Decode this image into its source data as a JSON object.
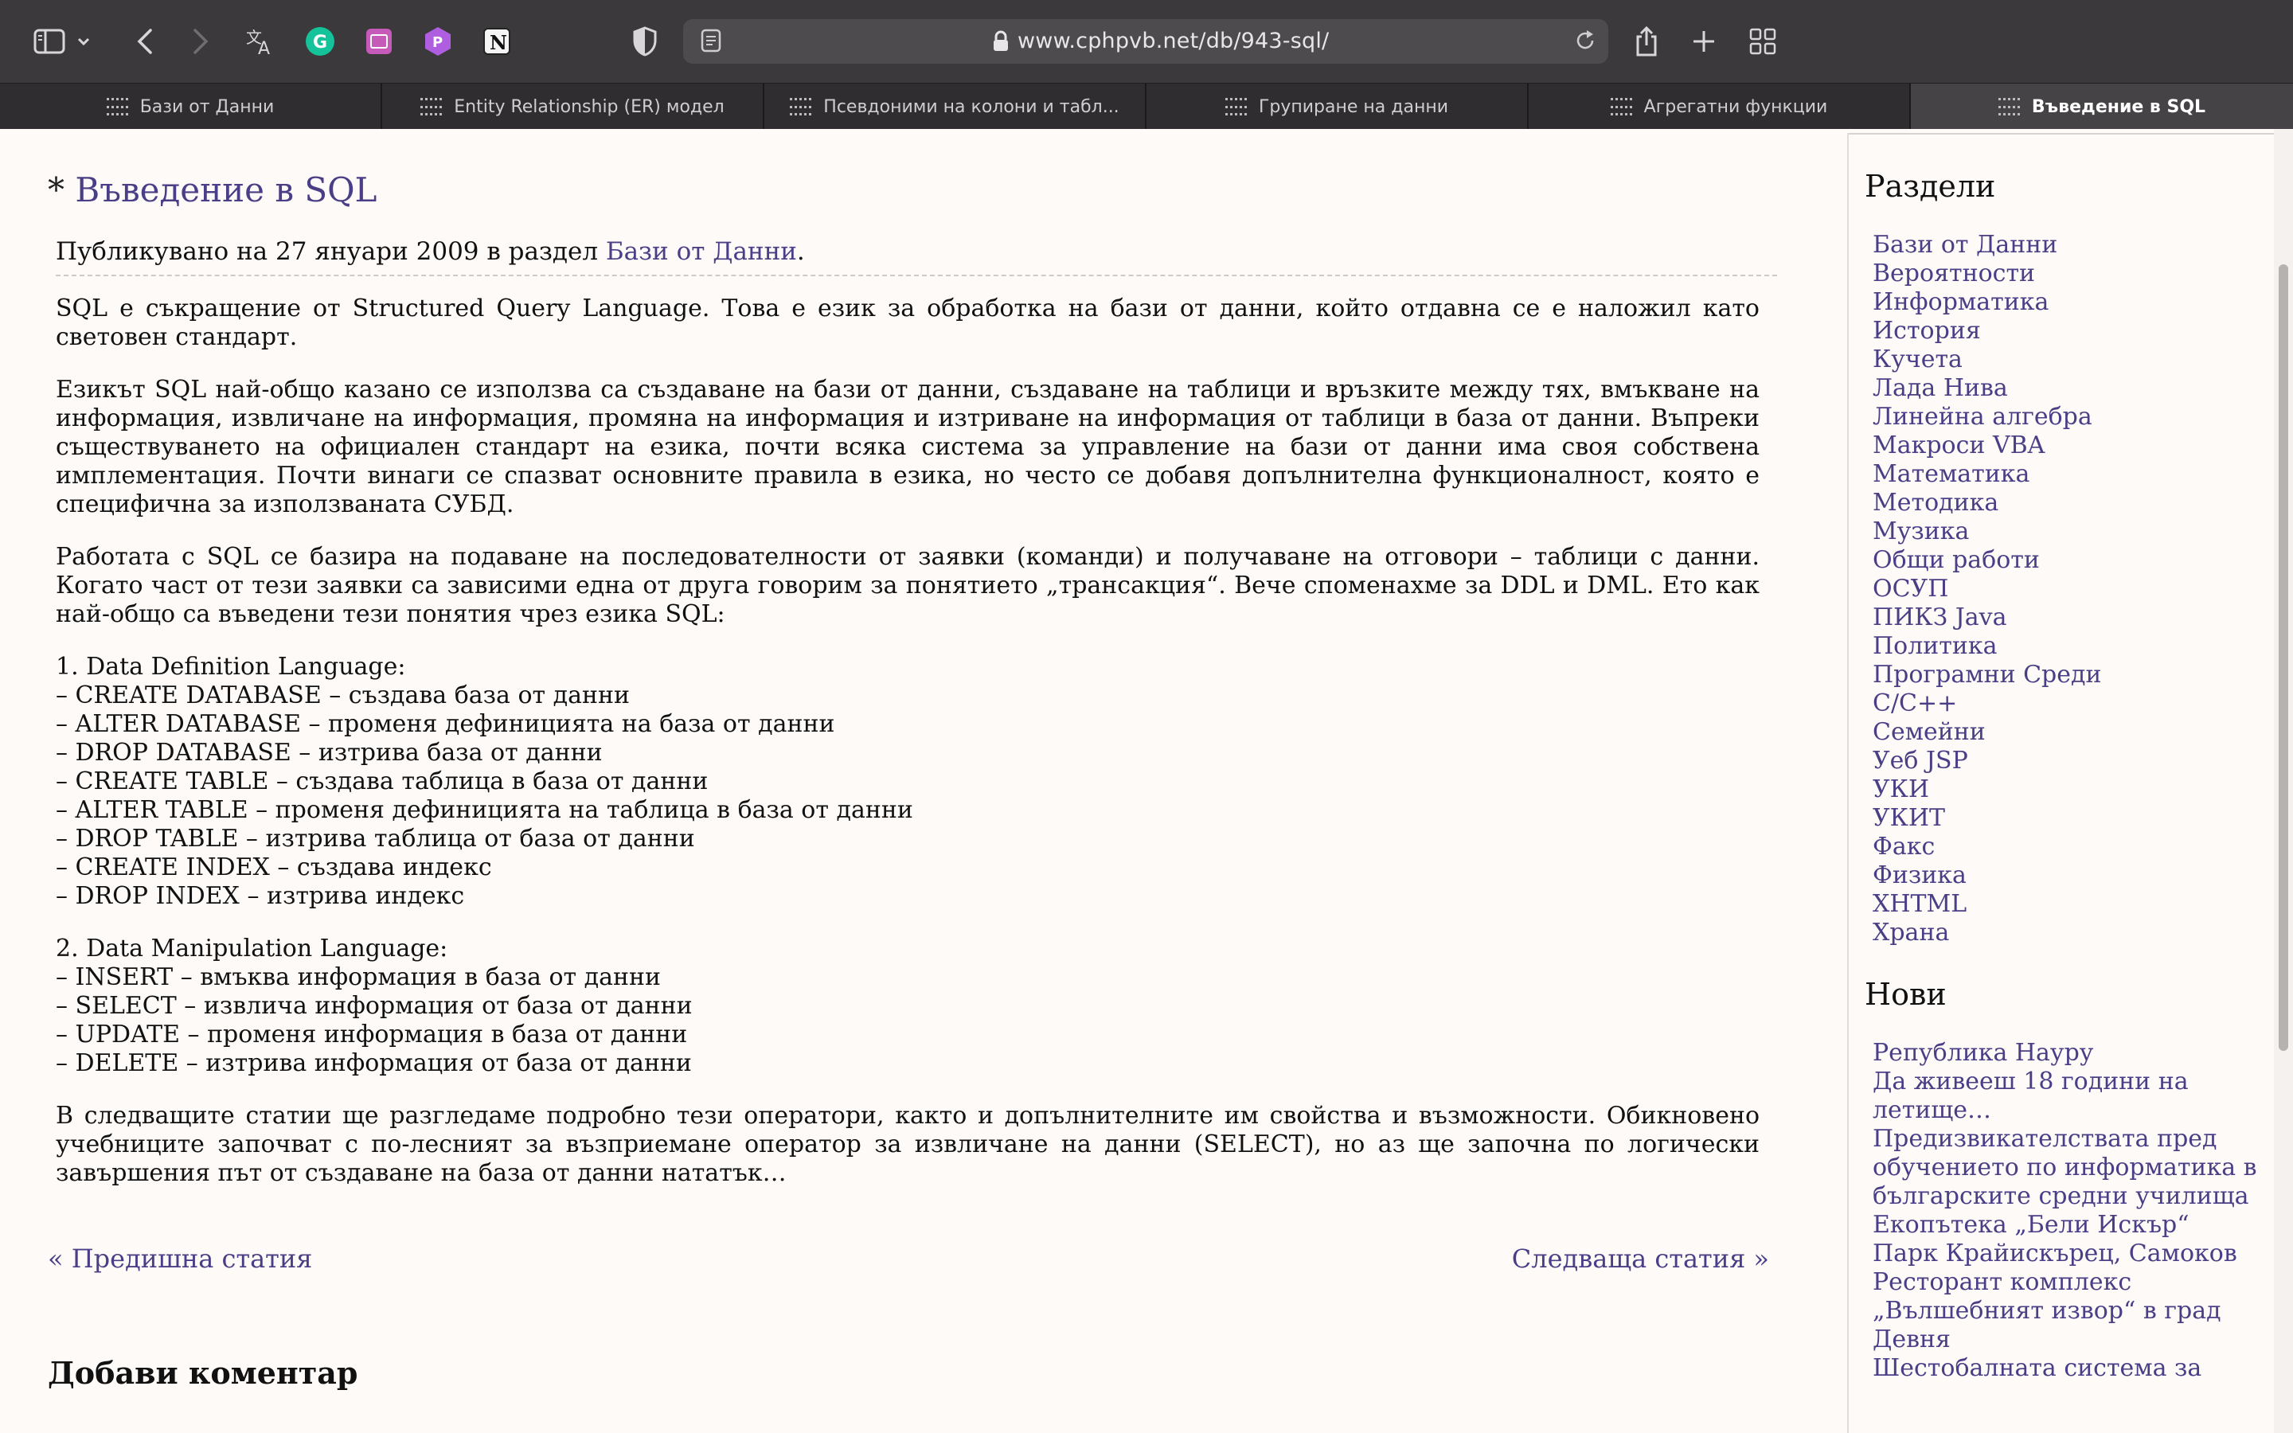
{
  "browser": {
    "url": "www.cphpvb.net/db/943-sql/",
    "tabs": [
      {
        "label": "Бази от Данни",
        "active": false
      },
      {
        "label": "Entity Relationship (ER) модел",
        "active": false
      },
      {
        "label": "Псевдоними на колони и табл...",
        "active": false
      },
      {
        "label": "Групиране на данни",
        "active": false
      },
      {
        "label": "Агрегатни функции",
        "active": false
      },
      {
        "label": "Въведение в SQL",
        "active": true
      }
    ],
    "icons": [
      "sidebar-icon",
      "chevron-down-icon",
      "back-icon",
      "forward-icon",
      "translate-icon",
      "grammarly-icon",
      "extension-icon",
      "extension-icon",
      "notion-icon",
      "privacy-shield-icon",
      "reader-icon",
      "lock-icon",
      "reload-icon",
      "share-icon",
      "new-tab-icon",
      "tab-overview-icon"
    ]
  },
  "post": {
    "title_prefix": "*",
    "title": "Въведение в SQL",
    "meta_text": "Публикувано на 27 януари 2009 в раздел",
    "meta_category": "Бази от Данни",
    "meta_end": ".",
    "paragraphs": [
      "SQL е съкращение от Structured Query Language. Това е език за обработка на бази от данни, който отдавна се е наложил като световен стандарт.",
      "Езикът SQL най-общо казано се използва са създаване на бази от данни, създаване на таблици и връзките между тях, вмъкване на информация, извличане на информация, промяна на информация и изтриване на информация от таблици в база от данни. Въпреки съществуването на официален стандарт на езика, почти всяка система за управление на бази от данни има своя собствена имплементация. Почти винаги се спазват основните правила в езика, но често се добавя допълнителна функционалност, която е специфична за използваната СУБД.",
      "Работата с SQL се базира на подаване на последователности от заявки (команди) и получаване на отговори – таблици с данни. Когато част от тези заявки са зависими една от друга говорим за понятието „трансакция“. Вече споменахме за DDL и DML. Ето как най-общо са въведени тези понятия чрез езика SQL:"
    ],
    "ddl_list": [
      "1. Data Definition Language:",
      "– CREATE DATABASE – създава база от данни",
      "– ALTER DATABASE – променя дефиницията на база от данни",
      "– DROP DATABASE – изтрива база от данни",
      "– CREATE TABLE – създава таблица в база от данни",
      "– ALTER TABLE – променя дефиницията на таблица в база от данни",
      "– DROP TABLE – изтрива таблица от база от данни",
      "– CREATE INDEX – създава индекс",
      "– DROP INDEX – изтрива индекс"
    ],
    "dml_list": [
      "2. Data Manipulation Language:",
      "– INSERT – вмъква информация в база от данни",
      "– SELECT – извлича информация от база от данни",
      "– UPDATE – променя информация в база от данни",
      "– DELETE – изтрива информация от база от данни"
    ],
    "closing_paragraph": "В следващите статии ще разгледаме подробно тези оператори, както и допълнителните им свойства и възможности. Обикновено учебниците започват с по-лесният за възприемане оператор за извличане на данни (SELECT), но аз ще започна по логически завършения път от създаване на база от данни нататък…",
    "prev_link": "« Предишна статия",
    "next_link": "Следваща статия »",
    "comment_heading": "Добави коментар"
  },
  "sidebar": {
    "sections_heading": "Раздели",
    "sections": [
      "Бази от Данни",
      "Вероятности",
      "Информатика",
      "История",
      "Кучета",
      "Лада Нива",
      "Линейна алгебра",
      "Макроси VBA",
      "Математика",
      "Методика",
      "Музика",
      "Общи работи",
      "ОСУП",
      "ПИКЗ Java",
      "Политика",
      "Програмни Среди",
      "C/C++",
      "Семейни",
      "Уеб JSP",
      "УКИ",
      "УКИТ",
      "Факс",
      "Физика",
      "XHTML",
      "Храна"
    ],
    "new_heading": "Нови",
    "new_posts": [
      "Република Науру",
      "Да живееш 18 години на летище…",
      "Предизвикателствата пред обучението по информатика в българските средни училища",
      "Екопътека „Бели Искър“",
      "Парк Крайискърец, Самоков",
      "Ресторант комплекс „Вълшебният извор“ в град Девня",
      "Шестобалната система за"
    ]
  }
}
